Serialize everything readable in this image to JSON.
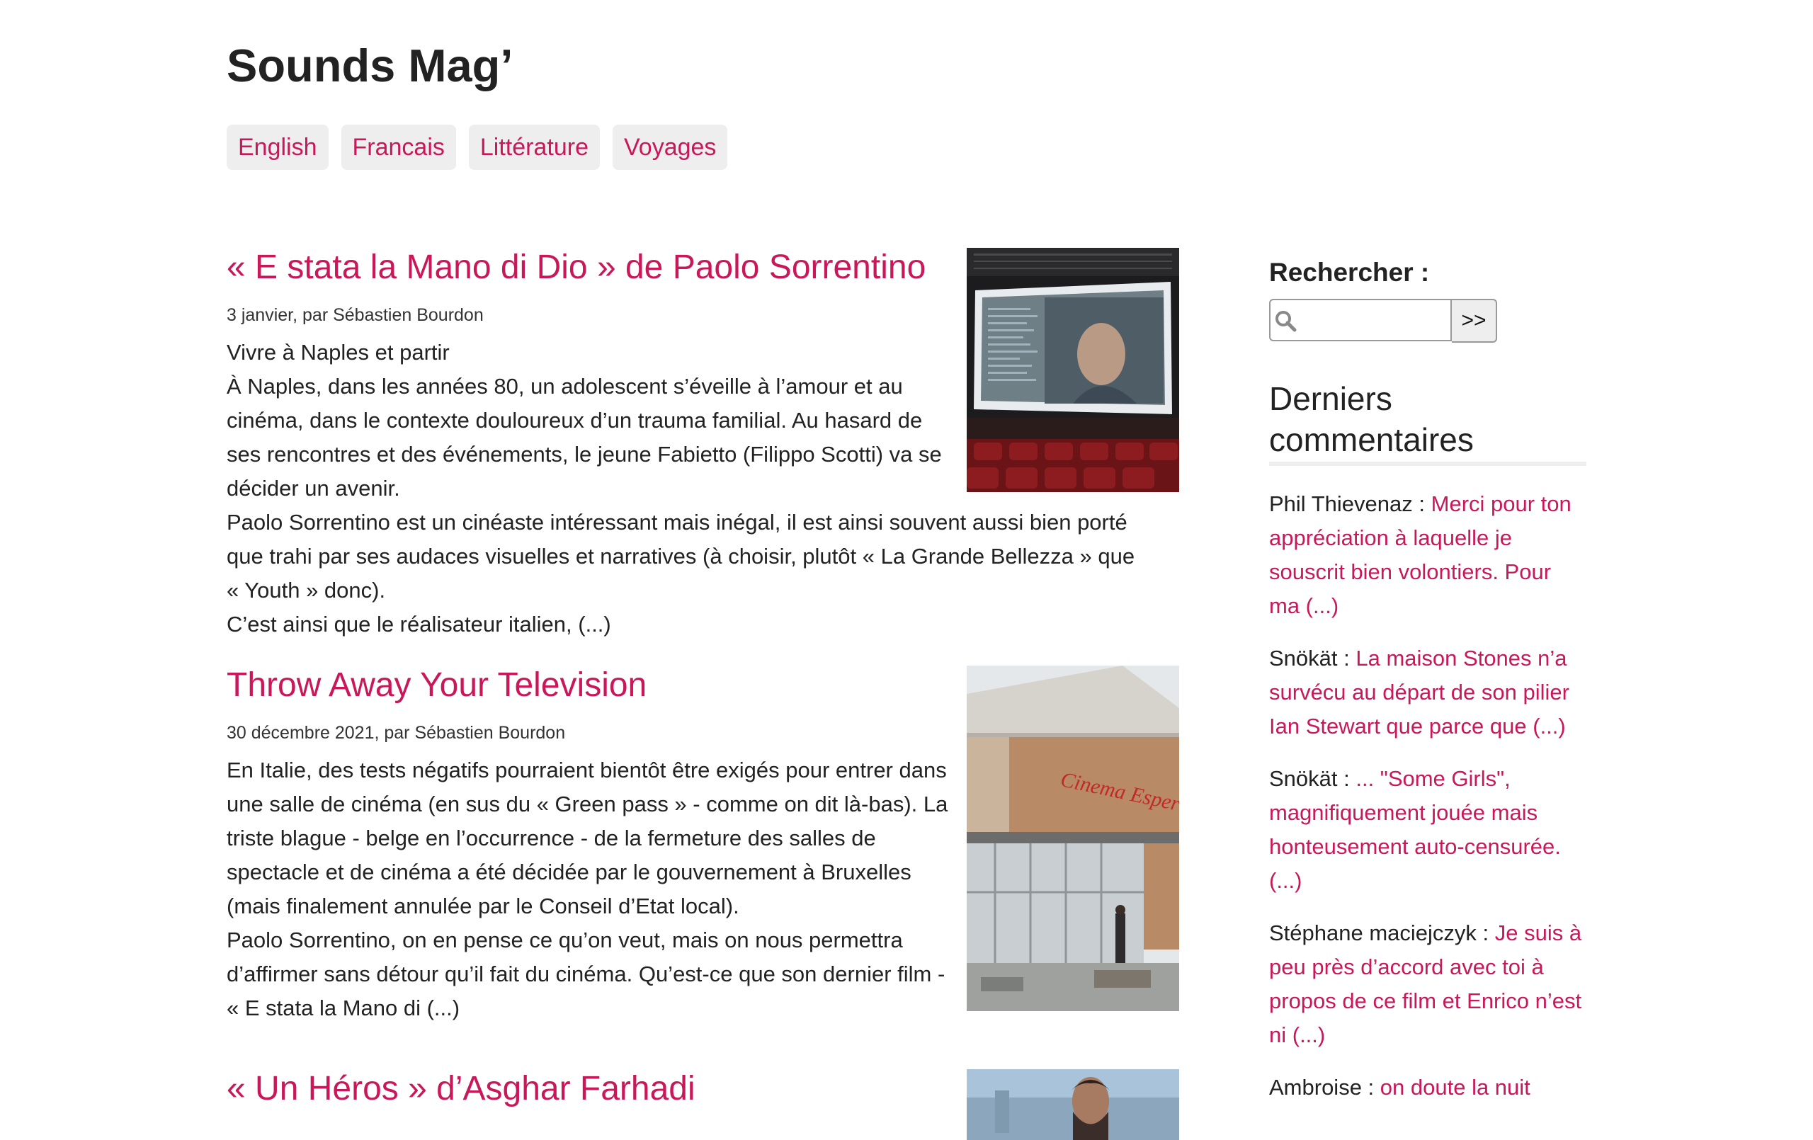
{
  "site": {
    "title": "Sounds Mag’"
  },
  "nav": [
    {
      "label": "English"
    },
    {
      "label": "Francais"
    },
    {
      "label": "Littérature"
    },
    {
      "label": "Voyages"
    }
  ],
  "articles": [
    {
      "title": "« E stata la Mano di Dio » de Paolo Sorrentino",
      "meta": "3 janvier, par Sébastien Bourdon",
      "lines": [
        "Vivre à Naples et partir",
        "À Naples, dans les années 80, un adolescent s’éveille à l’amour et au cinéma, dans le contexte douloureux d’un trauma familial. Au hasard de ses rencontres et des événements, le jeune Fabietto (Filippo Scotti) va se décider un avenir.",
        "Paolo Sorrentino est un cinéaste intéressant mais inégal, il est ainsi souvent aussi bien porté que trahi par ses audaces visuelles et narratives (à choisir, plutôt « La Grande Bellezza » que « Youth » donc).",
        "C’est ainsi que le réalisateur italien, (...)"
      ]
    },
    {
      "title": "Throw Away Your Television",
      "meta": "30 décembre 2021, par Sébastien Bourdon",
      "lines": [
        "En Italie, des tests négatifs pourraient bientôt être exigés pour entrer dans une salle de cinéma (en sus du « Green pass » - comme on dit là-bas). La triste blague - belge en l’occurrence - de la fermeture des salles de spectacle et de cinéma a été décidée par le gouvernement à Bruxelles (mais finalement annulée par le Conseil d’Etat local).",
        "Paolo Sorrentino, on en pense ce qu’on veut, mais on nous permettra d’affirmer sans détour qu’il fait du cinéma. Qu’est-ce que son dernier film - « E stata la Mano di (...)"
      ],
      "sign_text": "Cinema Esperia"
    },
    {
      "title": "« Un Héros » d’Asghar Farhadi"
    }
  ],
  "sidebar": {
    "search_title": "Rechercher :",
    "search_button": ">>",
    "comments_title": "Derniers commentaires",
    "comments": [
      {
        "author": "Phil Thievenaz  : ",
        "text": "Merci pour ton appréciation à laquelle je souscrit bien volontiers. Pour ma (...)"
      },
      {
        "author": "Snökät : ",
        "text": "La maison Stones n’a survécu au départ de son pilier Ian Stewart que parce que (...)"
      },
      {
        "author": "Snökät : ",
        "text": "... \"Some Girls\", magnifiquement jouée mais honteusement auto-censurée. (...)"
      },
      {
        "author": "Stéphane maciejczyk  : ",
        "text": "Je suis à peu près d’accord avec toi à propos de ce film et Enrico n’est ni (...)"
      },
      {
        "author": "Ambroise : ",
        "text": "on doute la nuit"
      }
    ]
  }
}
